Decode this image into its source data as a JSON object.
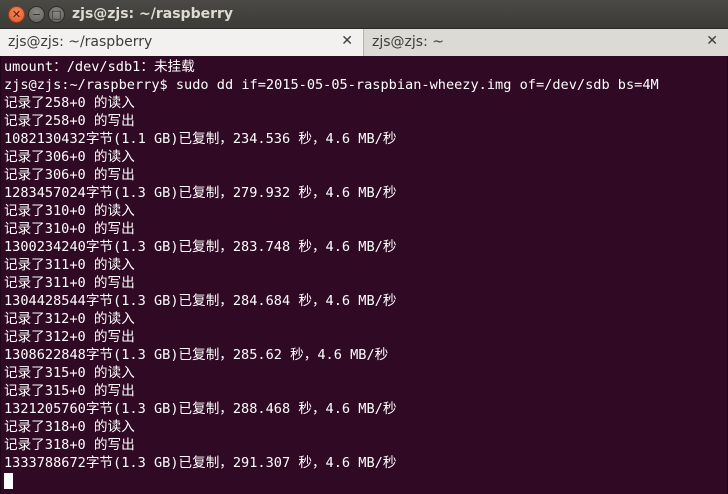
{
  "window": {
    "title": "zjs@zjs: ~/raspberry",
    "close_glyph": "✕",
    "minimize_glyph": "−",
    "maximize_glyph": "□"
  },
  "tabs": [
    {
      "label": "zjs@zjs: ~/raspberry",
      "close_glyph": "✕",
      "active": true
    },
    {
      "label": "zjs@zjs: ~",
      "close_glyph": "✕",
      "active": false
    }
  ],
  "terminal": {
    "background": "#300a24",
    "foreground": "#ffffff",
    "lines": [
      "umount：/dev/sdb1：未挂载",
      "zjs@zjs:~/raspberry$ sudo dd if=2015-05-05-raspbian-wheezy.img of=/dev/sdb bs=4M",
      "记录了258+0 的读入",
      "记录了258+0 的写出",
      "1082130432字节(1.1 GB)已复制，234.536 秒，4.6 MB/秒",
      "记录了306+0 的读入",
      "记录了306+0 的写出",
      "1283457024字节(1.3 GB)已复制，279.932 秒，4.6 MB/秒",
      "记录了310+0 的读入",
      "记录了310+0 的写出",
      "1300234240字节(1.3 GB)已复制，283.748 秒，4.6 MB/秒",
      "记录了311+0 的读入",
      "记录了311+0 的写出",
      "1304428544字节(1.3 GB)已复制，284.684 秒，4.6 MB/秒",
      "记录了312+0 的读入",
      "记录了312+0 的写出",
      "1308622848字节(1.3 GB)已复制，285.62 秒，4.6 MB/秒",
      "记录了315+0 的读入",
      "记录了315+0 的写出",
      "1321205760字节(1.3 GB)已复制，288.468 秒，4.6 MB/秒",
      "记录了318+0 的读入",
      "记录了318+0 的写出",
      "1333788672字节(1.3 GB)已复制，291.307 秒，4.6 MB/秒"
    ]
  }
}
